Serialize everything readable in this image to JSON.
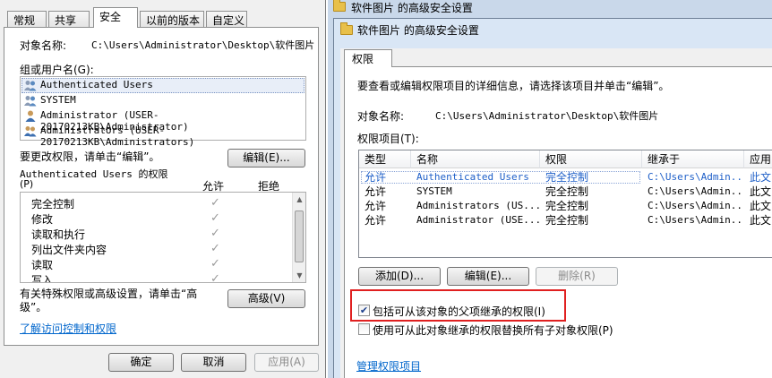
{
  "left_dialog": {
    "tabs": [
      "常规",
      "共享",
      "安全",
      "以前的版本",
      "自定义"
    ],
    "active_tab": "安全",
    "object_name_label": "对象名称:",
    "object_name_value": "C:\\Users\\Administrator\\Desktop\\软件图片",
    "group_label": "组或用户名(G):",
    "users": [
      "Authenticated Users",
      "SYSTEM",
      "Administrator (USER-20170213KB\\Administrator)",
      "Administrators (USER-20170213KB\\Administrators)"
    ],
    "change_perm_text": "要更改权限，请单击“编辑”。",
    "edit_button": "编辑(E)...",
    "perm_for_label": "Authenticated Users 的权限",
    "perm_for_suffix": "(P)",
    "allow_header": "允许",
    "deny_header": "拒绝",
    "permissions": [
      {
        "name": "完全控制",
        "allow": "✓"
      },
      {
        "name": "修改",
        "allow": "✓"
      },
      {
        "name": "读取和执行",
        "allow": "✓"
      },
      {
        "name": "列出文件夹内容",
        "allow": "✓"
      },
      {
        "name": "读取",
        "allow": "✓"
      },
      {
        "name": "写入",
        "allow": "✓"
      }
    ],
    "special_text": "有关特殊权限或高级设置，请单击“高级”。",
    "advanced_button": "高级(V)",
    "learn_link": "了解访问控制和权限",
    "ok_button": "确定",
    "cancel_button": "取消",
    "apply_button": "应用(A)"
  },
  "right_window": {
    "back_title": "软件图片 的高级安全设置",
    "front_title": "软件图片 的高级安全设置",
    "tab": "权限",
    "intro": "要查看或编辑权限项目的详细信息，请选择该项目并单击“编辑”。",
    "object_name_label": "对象名称:",
    "object_name_value": "C:\\Users\\Administrator\\Desktop\\软件图片",
    "entries_label": "权限项目(T):",
    "columns": [
      "类型",
      "名称",
      "权限",
      "继承于",
      "应用"
    ],
    "rows": [
      [
        "允许",
        "Authenticated Users",
        "完全控制",
        "C:\\Users\\Admin...",
        "此文"
      ],
      [
        "允许",
        "SYSTEM",
        "完全控制",
        "C:\\Users\\Admin...",
        "此文"
      ],
      [
        "允许",
        "Administrators (US...",
        "完全控制",
        "C:\\Users\\Admin...",
        "此文"
      ],
      [
        "允许",
        "Administrator (USE...",
        "完全控制",
        "C:\\Users\\Admin...",
        "此文"
      ]
    ],
    "add_button": "添加(D)...",
    "edit_button": "编辑(E)...",
    "remove_button": "删除(R)",
    "inherit_checkbox": "包括可从该对象的父项继承的权限(I)",
    "inherit_checked": "✔",
    "replace_checkbox": "使用可从此对象继承的权限替换所有子对象权限(P)",
    "manage_link": "管理权限项目"
  }
}
